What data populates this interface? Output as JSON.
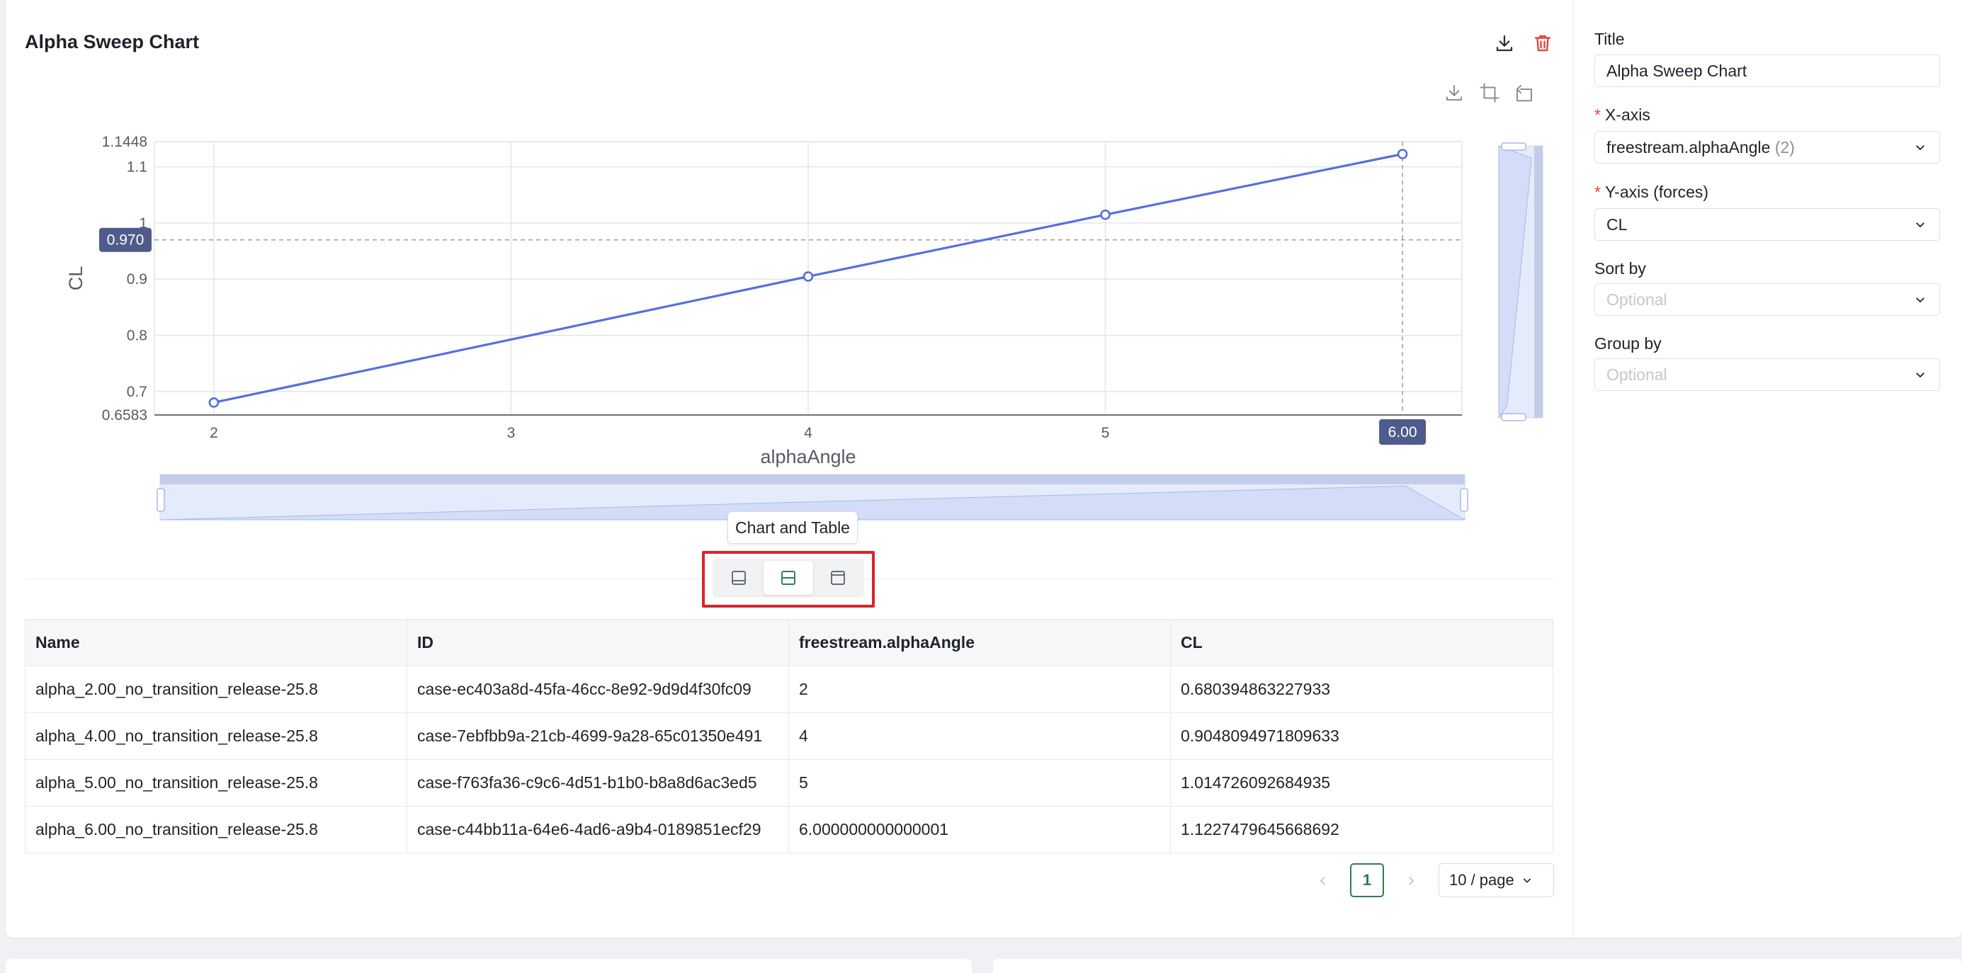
{
  "chart_title": "Alpha Sweep Chart",
  "colors": {
    "line": "#5470e0",
    "badge": "#4e5b8c",
    "accent": "#2e7d52",
    "danger": "#e0463b"
  },
  "chart_data": {
    "type": "line",
    "xlabel": "alphaAngle",
    "ylabel": "CL",
    "xlim": [
      1.8,
      6.2
    ],
    "ylim": [
      0.6583,
      1.1448
    ],
    "x_ticks": [
      "2",
      "3",
      "4",
      "5"
    ],
    "x_tick_values": [
      2,
      3,
      4,
      5
    ],
    "y_ticks": [
      "0.6583",
      "0.7",
      "0.8",
      "0.9",
      "1",
      "1.1",
      "1.1448"
    ],
    "y_tick_values": [
      0.6583,
      0.7,
      0.8,
      0.9,
      1.0,
      1.1,
      1.1448
    ],
    "x": [
      2,
      4,
      5,
      6.000000000000001
    ],
    "y": [
      0.680394863227933,
      0.9048094971809633,
      1.014726092684935,
      1.1227479645668692
    ],
    "crosshair": {
      "x_label": "6.00",
      "y_label": "0.970",
      "x_value": 6.0,
      "y_value": 0.97
    },
    "grid": true
  },
  "view_toggle": {
    "tooltip": "Chart and Table"
  },
  "table": {
    "headers": [
      "Name",
      "ID",
      "freestream.alphaAngle",
      "CL"
    ],
    "rows": [
      [
        "alpha_2.00_no_transition_release-25.8",
        "case-ec403a8d-45fa-46cc-8e92-9d9d4f30fc09",
        "2",
        "0.680394863227933"
      ],
      [
        "alpha_4.00_no_transition_release-25.8",
        "case-7ebfbb9a-21cb-4699-9a28-65c01350e491",
        "4",
        "0.9048094971809633"
      ],
      [
        "alpha_5.00_no_transition_release-25.8",
        "case-f763fa36-c9c6-4d51-b1b0-b8a8d6ac3ed5",
        "5",
        "1.014726092684935"
      ],
      [
        "alpha_6.00_no_transition_release-25.8",
        "case-c44bb11a-64e6-4ad6-a9b4-0189851ecf29",
        "6.000000000000001",
        "1.1227479645668692"
      ]
    ]
  },
  "pagination": {
    "page": "1",
    "page_size": "10 / page"
  },
  "form": {
    "title_label": "Title",
    "title_value": "Alpha Sweep Chart",
    "xaxis_label": "X-axis",
    "xaxis_value": "freestream.alphaAngle",
    "xaxis_count": "(2)",
    "yaxis_label": "Y-axis (forces)",
    "yaxis_value": "CL",
    "sortby_label": "Sort by",
    "sortby_placeholder": "Optional",
    "groupby_label": "Group by",
    "groupby_placeholder": "Optional",
    "required_mark": "*"
  }
}
